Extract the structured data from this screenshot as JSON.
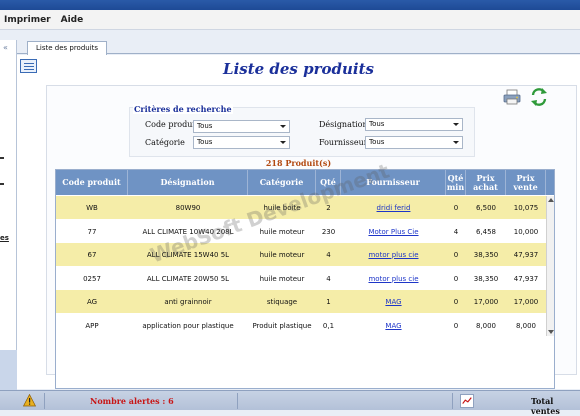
{
  "menu": {
    "items": [
      "Imprimer",
      "Aide"
    ]
  },
  "tab": {
    "label": "Liste des produits"
  },
  "page": {
    "title": "Liste des produits"
  },
  "criteria": {
    "title": "Critères de recherche",
    "code_label": "Code produit",
    "code_value": "Tous",
    "designation_label": "Désignation",
    "designation_value": "Tous",
    "category_label": "Catégorie",
    "category_value": "Tous",
    "supplier_label": "Fournisseur",
    "supplier_value": "Tous"
  },
  "count_text": "218 Produit(s)",
  "table": {
    "columns": [
      "Code produit",
      "Désignation",
      "Catégorie",
      "Qté",
      "Fournisseur",
      "Qté min",
      "Prix achat",
      "Prix vente"
    ],
    "rows": [
      [
        "WB",
        "80W90",
        "huile boite",
        "2",
        "dridi ferid",
        "0",
        "6,500",
        "10,075"
      ],
      [
        "77",
        "ALL CLIMATE 10W40 208L",
        "huile moteur",
        "230",
        "Motor Plus Cie",
        "4",
        "6,458",
        "10,000"
      ],
      [
        "67",
        "ALL CLIMATE 15W40 5L",
        "huile moteur",
        "4",
        "motor plus cie",
        "0",
        "38,350",
        "47,937"
      ],
      [
        "0257",
        "ALL CLIMATE 20W50 5L",
        "huile moteur",
        "4",
        "motor plus cie",
        "0",
        "38,350",
        "47,937"
      ],
      [
        "AG",
        "anti grainnoir",
        "stiquage",
        "1",
        "MAG",
        "0",
        "17,000",
        "17,000"
      ],
      [
        "APP",
        "application pour plastique",
        "Produit plastique",
        "0,1",
        "MAG",
        "0",
        "8,000",
        "8,000"
      ]
    ]
  },
  "watermark": "WebSoft Development",
  "left_panel": {
    "partial_label": "es"
  },
  "status": {
    "alerts_label": "Nombre alertes",
    "alerts_count": "6",
    "alerts_text": "Nombre alertes  :  6",
    "sales_label": "Total ventes"
  },
  "colors": {
    "accent": "#1a2f9a",
    "header": "#6f93c4",
    "row_highlight": "#f5eda8",
    "alert": "#c81515",
    "count": "#b34a12"
  },
  "icons": [
    "list-icon",
    "printer-icon",
    "refresh-icon",
    "alert-icon",
    "sales-icon",
    "chevron-down-icon"
  ]
}
